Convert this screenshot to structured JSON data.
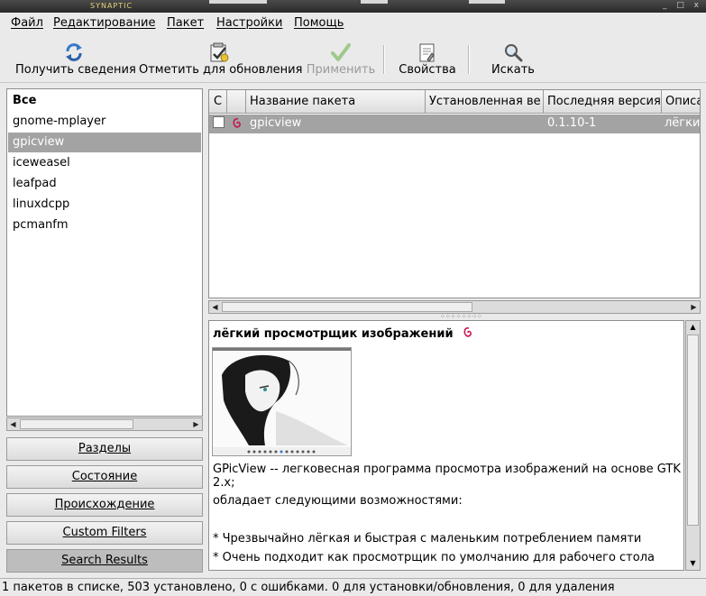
{
  "window": {
    "title": "SYNAPTIC",
    "controls": "_ □ x"
  },
  "menu": [
    "Файл",
    "Редактирование",
    "Пакет",
    "Настройки",
    "Помощь"
  ],
  "toolbar": {
    "reload": "Получить сведения",
    "mark": "Отметить для обновления",
    "apply": "Применить",
    "properties": "Свойства",
    "search": "Искать"
  },
  "sidebar": {
    "items": [
      "Все",
      "gnome-mplayer",
      "gpicview",
      "iceweasel",
      "leafpad",
      "linuxdcpp",
      "pcmanfm"
    ],
    "selected": "gpicview",
    "buttons": [
      "Разделы",
      "Состояние",
      "Происхождение",
      "Custom Filters",
      "Search Results"
    ]
  },
  "table": {
    "columns": [
      "С",
      "",
      "Название пакета",
      "Установленная ве",
      "Последняя версия",
      "Описа"
    ],
    "rows": [
      {
        "name": "gpicview",
        "installed": "",
        "latest": "0.1.10-1",
        "description": "лёгки"
      }
    ]
  },
  "description": {
    "title": "лёгкий просмотрщик изображений",
    "lines": [
      "GPicView -- легковесная программа просмотра изображений на основе GTK +",
      "2.x;",
      "обладает следующими возможностями:",
      "",
      " * Чрезвычайно лёгкая и быстрая с маленьким потреблением памяти",
      " * Очень подходит как просмотрщик по умолчанию для рабочего стола"
    ]
  },
  "status": "1 пакетов в списке, 503 установлено, 0 с ошибками. 0 для установки/обновления, 0 для удаления",
  "colors": {
    "selection": "#a3a3a3",
    "debian": "#c7184f",
    "refresh": "#3a78c8",
    "check": "#6aa84f"
  }
}
